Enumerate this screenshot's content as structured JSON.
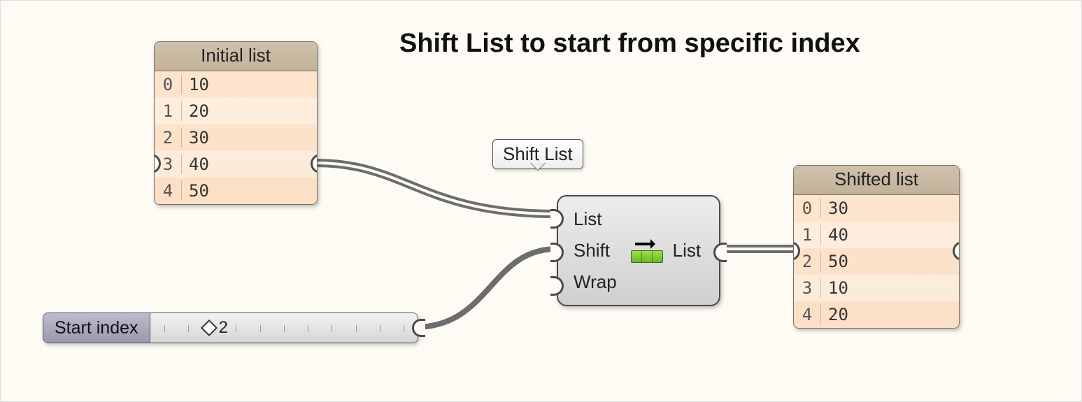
{
  "title": "Shift List to start from specific index",
  "panels": {
    "initial": {
      "title": "Initial list",
      "rows": [
        {
          "index": "0",
          "value": "10"
        },
        {
          "index": "1",
          "value": "20"
        },
        {
          "index": "2",
          "value": "30"
        },
        {
          "index": "3",
          "value": "40"
        },
        {
          "index": "4",
          "value": "50"
        }
      ]
    },
    "shifted": {
      "title": "Shifted list",
      "rows": [
        {
          "index": "0",
          "value": "30"
        },
        {
          "index": "1",
          "value": "40"
        },
        {
          "index": "2",
          "value": "50"
        },
        {
          "index": "3",
          "value": "10"
        },
        {
          "index": "4",
          "value": "20"
        }
      ]
    }
  },
  "component": {
    "tooltip": "Shift List",
    "inputs": [
      "List",
      "Shift",
      "Wrap"
    ],
    "output": "List",
    "icon": "shift-list-icon"
  },
  "slider": {
    "label": "Start index",
    "value": "2",
    "min": 0,
    "max": 10
  },
  "colors": {
    "canvas": "#fdfbf4",
    "panel_header": "#c7b8a1",
    "panel_body": "#fce3cb",
    "wire": "#6d6d6d"
  }
}
